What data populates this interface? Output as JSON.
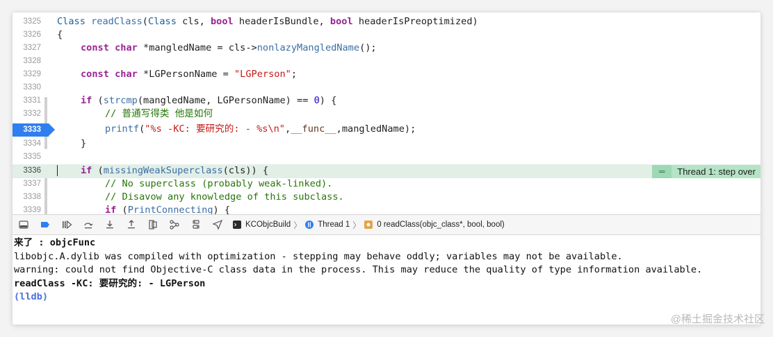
{
  "editor": {
    "lines": [
      {
        "n": "3325"
      },
      {
        "n": "3326"
      },
      {
        "n": "3327"
      },
      {
        "n": "3328"
      },
      {
        "n": "3329"
      },
      {
        "n": "3330"
      },
      {
        "n": "3331"
      },
      {
        "n": "3332"
      },
      {
        "n": "3333"
      },
      {
        "n": "3334"
      },
      {
        "n": "3335"
      },
      {
        "n": "3336"
      },
      {
        "n": "3337"
      },
      {
        "n": "3338"
      },
      {
        "n": "3339"
      }
    ],
    "code": {
      "l3325": {
        "t1": "Class",
        "t2": "readClass",
        "t3": "(",
        "t4": "Class",
        "t5": " cls, ",
        "t6": "bool",
        "t7": " headerIsBundle, ",
        "t8": "bool",
        "t9": " headerIsPreoptimized)"
      },
      "l3326": "{",
      "l3327": {
        "k1": "const",
        "k2": "char",
        "t1": " *mangledName = cls->",
        "t2": "nonlazyMangledName",
        "t3": "();"
      },
      "l3329": {
        "k1": "const",
        "k2": "char",
        "t1": " *LGPersonName = ",
        "s": "\"LGPerson\"",
        "t2": ";"
      },
      "l3331": {
        "k1": "if",
        "t1": " (",
        "f": "strcmp",
        "t2": "(mangledName, LGPersonName) == ",
        "num": "0",
        "t3": ") {"
      },
      "l3332": "// 普通写得类 他是如何",
      "l3333": {
        "f": "printf",
        "t1": "(",
        "s": "\"%s -KC: 要研究的: - %s\\n\"",
        "t2": ",",
        "m": "__func__",
        "t3": ",mangledName);"
      },
      "l3334": "}",
      "l3336": {
        "k1": "if",
        "t1": " (",
        "f": "missingWeakSuperclass",
        "t2": "(cls)) {"
      },
      "l3337": "// No superclass (probably weak-linked).",
      "l3338": "// Disavow any knowledge of this subclass.",
      "l3339": {
        "k1": "if",
        "t1": " (",
        "f": "PrintConnecting",
        "t2": ") {"
      }
    },
    "breakpoint_line": "3333",
    "current_line": "3336",
    "thread_badge": "Thread 1: step over"
  },
  "debugbar": {
    "buttons": [
      "hide-debug-area-icon",
      "breakpoints-toggle-icon",
      "continue-icon",
      "step-over-icon",
      "step-into-icon",
      "step-out-icon",
      "view-hierarchy-icon",
      "memory-graph-icon",
      "environment-overrides-icon",
      "simulate-location-icon"
    ],
    "crumbs": {
      "target": "KCObjcBuild",
      "thread": "Thread 1",
      "frame": "0 readClass(objc_class*, bool, bool)"
    }
  },
  "console": {
    "lines": [
      "来了 : objcFunc",
      "libobjc.A.dylib was compiled with optimization - stepping may behave oddly; variables may not be available.",
      "warning: could not find Objective-C class data in the process. This may reduce the quality of type information available.",
      "readClass -KC: 要研究的: - LGPerson",
      "(lldb)"
    ]
  },
  "watermark": "@稀土掘金技术社区",
  "colors": {
    "breakpoint": "#2f7ff0",
    "current_line": "#e1efe7",
    "thread_badge": "#b5e3c6",
    "keyword": "#9b2393",
    "string": "#c41a16",
    "comment": "#267507",
    "lldb": "#4a6fd9"
  }
}
